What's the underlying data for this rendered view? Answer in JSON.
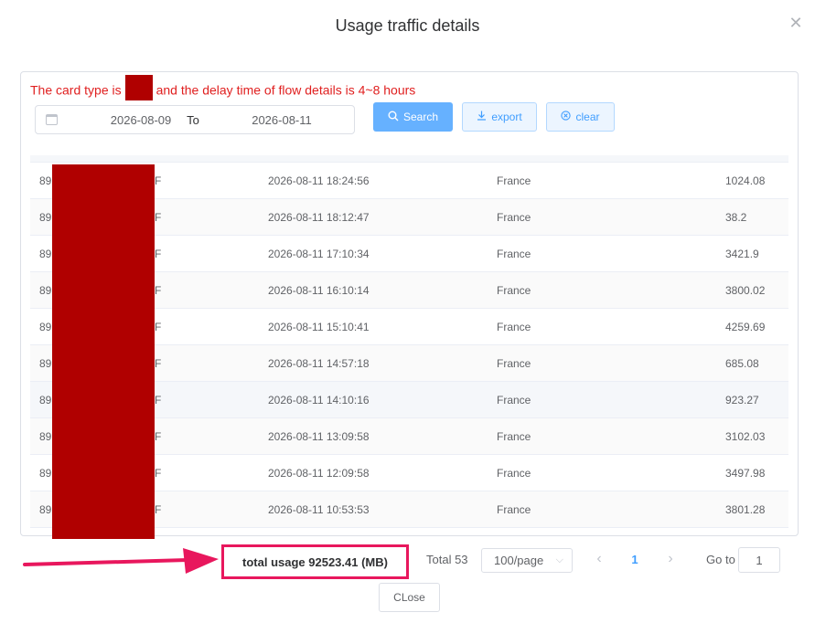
{
  "dialog": {
    "title": "Usage traffic details",
    "close_icon": "close-icon"
  },
  "notice": {
    "before": "The card type is",
    "after": "and the delay time of flow details is 4~8 hours"
  },
  "filters": {
    "start_date": "2026-08-09",
    "separator": "To",
    "end_date": "2026-08-11",
    "search_label": "Search",
    "export_label": "export",
    "clear_label": "clear"
  },
  "table": {
    "rows": [
      {
        "id_prefix": "89",
        "id_suffix": "F",
        "time": "2026-08-11 18:24:56",
        "country": "France",
        "usage": "1024.08"
      },
      {
        "id_prefix": "89",
        "id_suffix": "F",
        "time": "2026-08-11 18:12:47",
        "country": "France",
        "usage": "38.2"
      },
      {
        "id_prefix": "89",
        "id_suffix": "F",
        "time": "2026-08-11 17:10:34",
        "country": "France",
        "usage": "3421.9"
      },
      {
        "id_prefix": "89",
        "id_suffix": "F",
        "time": "2026-08-11 16:10:14",
        "country": "France",
        "usage": "3800.02"
      },
      {
        "id_prefix": "89",
        "id_suffix": "F",
        "time": "2026-08-11 15:10:41",
        "country": "France",
        "usage": "4259.69"
      },
      {
        "id_prefix": "89",
        "id_suffix": "F",
        "time": "2026-08-11 14:57:18",
        "country": "France",
        "usage": "685.08"
      },
      {
        "id_prefix": "89",
        "id_suffix": "F",
        "time": "2026-08-11 14:10:16",
        "country": "France",
        "usage": "923.27"
      },
      {
        "id_prefix": "89",
        "id_suffix": "F",
        "time": "2026-08-11 13:09:58",
        "country": "France",
        "usage": "3102.03"
      },
      {
        "id_prefix": "89",
        "id_suffix": "F",
        "time": "2026-08-11 12:09:58",
        "country": "France",
        "usage": "3497.98"
      },
      {
        "id_prefix": "89",
        "id_suffix": "F",
        "time": "2026-08-11 10:53:53",
        "country": "France",
        "usage": "3801.28"
      }
    ]
  },
  "footer": {
    "total_usage": "total usage 92523.41 (MB)",
    "total_count": "Total 53",
    "page_size": "100/page",
    "current_page": "1",
    "goto_label": "Go to",
    "goto_value": "1",
    "close_label": "CLose"
  },
  "colors": {
    "notice_text": "#e02020",
    "redaction": "#b00000",
    "highlight": "#e8175d",
    "primary": "#409eff"
  }
}
